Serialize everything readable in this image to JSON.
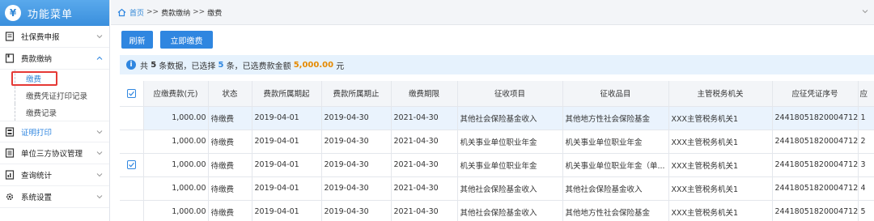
{
  "sidebar": {
    "title": "功能菜单",
    "logo": "¥",
    "items": [
      {
        "label": "社保费申报",
        "icon": "doc-icon"
      },
      {
        "label": "费款缴纳",
        "icon": "book-icon"
      },
      {
        "label": "证明打印",
        "icon": "print-doc-icon"
      },
      {
        "label": "单位三方协议管理",
        "icon": "doc-list-icon"
      },
      {
        "label": "查询统计",
        "icon": "chart-doc-icon"
      },
      {
        "label": "系统设置",
        "icon": "gear-icon"
      }
    ],
    "sub_items": [
      "缴费",
      "缴费凭证打印记录",
      "缴费记录"
    ]
  },
  "breadcrumb": {
    "home": "首页",
    "sep": ">>",
    "level2": "费款缴纳",
    "current": "缴费"
  },
  "toolbar": {
    "refresh": "刷新",
    "pay_now": "立即缴费"
  },
  "summary": {
    "prefix": "共",
    "total": "5",
    "mid1": "条数据，已选择",
    "selected": "5",
    "mid2": "条，已选费款金额",
    "amount": "5,000.00",
    "suffix": "元"
  },
  "table": {
    "headers": [
      "应缴费款(元)",
      "状态",
      "费款所属期起",
      "费款所属期止",
      "缴费期限",
      "征收项目",
      "征收品目",
      "主管税务机关",
      "应征凭证序号",
      "应"
    ],
    "rows": [
      {
        "amount": "1,000.00",
        "status": "待缴费",
        "start": "2019-04-01",
        "end": "2019-04-30",
        "deadline": "2021-04-30",
        "project": "其他社会保险基金收入",
        "item": "其他地方性社会保险基金",
        "office": "XXX主管税务机关1",
        "voucher": "244180518200047122",
        "last": "1"
      },
      {
        "amount": "1,000.00",
        "status": "待缴费",
        "start": "2019-04-01",
        "end": "2019-04-30",
        "deadline": "2021-04-30",
        "project": "机关事业单位职业年金",
        "item": "机关事业单位职业年金",
        "office": "XXX主管税务机关1",
        "voucher": "244180518200047122",
        "last": "2"
      },
      {
        "amount": "1,000.00",
        "status": "待缴费",
        "start": "2019-04-01",
        "end": "2019-04-30",
        "deadline": "2021-04-30",
        "project": "机关事业单位职业年金",
        "item": "机关事业单位职业年金（单...",
        "office": "XXX主管税务机关1",
        "voucher": "244180518200047122",
        "last": "3"
      },
      {
        "amount": "1,000.00",
        "status": "待缴费",
        "start": "2019-04-01",
        "end": "2019-04-30",
        "deadline": "2021-04-30",
        "project": "其他社会保险基金收入",
        "item": "其他社会保险基金收入",
        "office": "XXX主管税务机关1",
        "voucher": "244180518200047122",
        "last": "4"
      },
      {
        "amount": "1,000.00",
        "status": "待缴费",
        "start": "2019-04-01",
        "end": "2019-04-30",
        "deadline": "2021-04-30",
        "project": "其他社会保险基金收入",
        "item": "其他地方性社会保险基金",
        "office": "XXX主管税务机关1",
        "voucher": "244180518200047122",
        "last": "5"
      }
    ]
  },
  "colors": {
    "accent": "#2f86e0",
    "amount": "#e58a00",
    "highlight_box": "#e53935"
  }
}
